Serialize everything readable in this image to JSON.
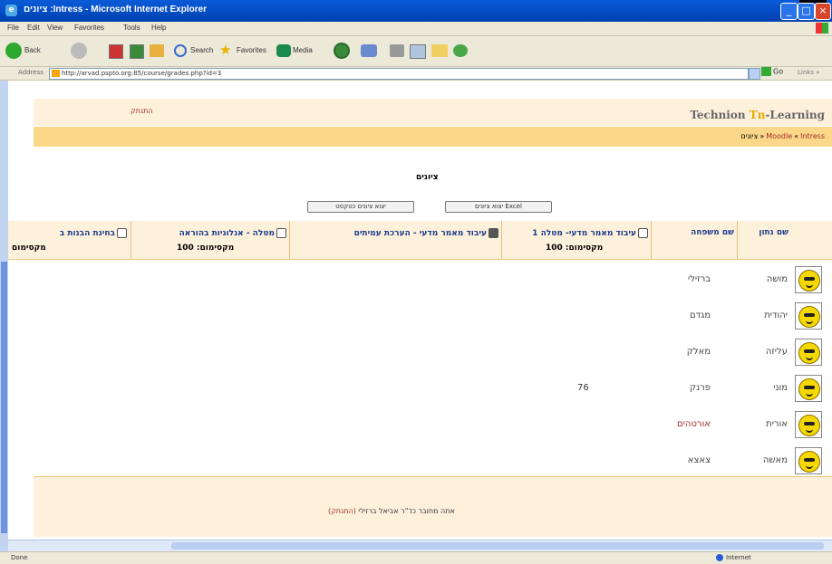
{
  "window": {
    "title": "ציונים :Intress - Microsoft Internet Explorer"
  },
  "menu": [
    "File",
    "Edit",
    "View",
    "Favorites",
    "Tools",
    "Help"
  ],
  "toolbar": {
    "back": "Back",
    "search": "Search",
    "favorites": "Favorites",
    "media": "Media"
  },
  "address": {
    "label": "Address",
    "url": "http://arvad.pspto.org:85/course/grades.php?id=3",
    "go": "Go",
    "links": "Links »"
  },
  "header": {
    "site_name_prefix": "Technion ",
    "site_name_logo": "Tn",
    "site_name_suffix": "-Learning",
    "login_link": "התנתק"
  },
  "breadcrumb": {
    "home": "Moodle",
    "course": "Intress",
    "current": "ציונים",
    "sep": "«"
  },
  "page_title": "ציונים",
  "buttons": {
    "excel": "יצוא ציונים Excel",
    "text": "יצוא ציונים כטקסט"
  },
  "table": {
    "headers": {
      "firstname": "שם נתון",
      "lastname": "שם משפחה",
      "col1_name": "עיבוד מאמר מדעי- מטלה 1",
      "col1_max": "מקסימום: 100",
      "col2_name": "עיבוד מאמר מדעי - הערכת עמיתים",
      "col3_name": "מטלה - אנלוגיות בהוראה",
      "col3_max": "מקסימום: 100",
      "col4_name": "בחינת הבנות ב",
      "col4_max": "מקסימום"
    },
    "rows": [
      {
        "firstname": "מושה",
        "lastname": "ברזילי",
        "grade1": ""
      },
      {
        "firstname": "יהודית",
        "lastname": "מגדם",
        "grade1": ""
      },
      {
        "firstname": "עליזה",
        "lastname": "מאלק",
        "grade1": ""
      },
      {
        "firstname": "מוני",
        "lastname": "פרנק",
        "grade1": "76"
      },
      {
        "firstname": "אורית",
        "lastname": "אורטהים",
        "grade1": ""
      },
      {
        "firstname": "מאשה",
        "lastname": "צאצא",
        "grade1": ""
      }
    ]
  },
  "footer": {
    "text": "אתה מחובר כד\"ר אביאל ברזילי",
    "logout": "(התנתק)"
  },
  "status": {
    "left": "Done",
    "zone": "Internet"
  }
}
